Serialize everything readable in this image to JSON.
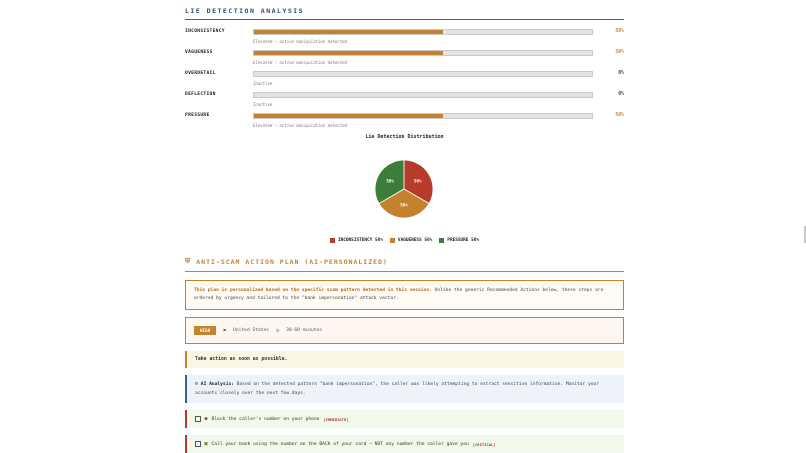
{
  "section_title": "LIE DETECTION ANALYSIS",
  "metrics": [
    {
      "label": "INCONSISTENCY",
      "value": 56,
      "pct": "56%",
      "note": "Elevated — active manipulation detected"
    },
    {
      "label": "VAGUENESS",
      "value": 56,
      "pct": "56%",
      "note": "Elevated — active manipulation detected"
    },
    {
      "label": "OVERDETAIL",
      "value": 0,
      "pct": "0%",
      "note": "Inactive"
    },
    {
      "label": "DEFLECTION",
      "value": 0,
      "pct": "0%",
      "note": "Inactive"
    },
    {
      "label": "PRESSURE",
      "value": 56,
      "pct": "56%",
      "note": "Elevated — active manipulation detected"
    }
  ],
  "chart_data": {
    "type": "pie",
    "title": "Lie Detection Distribution",
    "slices": [
      {
        "name": "INCONSISTENCY",
        "value": 56,
        "label": "56%",
        "color": "#b83a2b"
      },
      {
        "name": "VAGUENESS",
        "value": 56,
        "label": "56%",
        "color": "#c4822f"
      },
      {
        "name": "PRESSURE",
        "value": 56,
        "label": "56%",
        "color": "#3d7d3a"
      }
    ],
    "legend": [
      "INCONSISTENCY 56%",
      "VAGUENESS 56%",
      "PRESSURE 56%"
    ],
    "legend_position": "bottom"
  },
  "plan": {
    "icon": "shield-icon",
    "title": "ANTI-SCAM ACTION PLAN (AI-PERSONALIZED)",
    "intro_bold": "This plan is personalized based on the specific scam pattern detected in this session.",
    "intro_rest": " Unlike the generic Recommended Actions below, these steps are ordered by urgency and tailored to the \"bank impersonation\" attack vector.",
    "badge": "HIGH",
    "country": "United States",
    "duration": "30-60 minutes",
    "warning": "Take action as soon as possible.",
    "ai_label": "AI Analysis:",
    "ai_text": " Based on the detected pattern \"bank impersonation\", the caller was likely attempting to extract sensitive information. Monitor your accounts closely over the next few days.",
    "actions": [
      {
        "text": "Block the caller's number on your phone",
        "tag": "[IMMEDIATE]"
      },
      {
        "text": "Call your bank using the number on the BACK of your card — NOT any number the caller gave you",
        "tag": "[CRITICAL]"
      }
    ]
  },
  "colors": {
    "accent": "#c4822f",
    "navy": "#2b4a78",
    "red": "#b83a2b",
    "green": "#3d7d3a"
  }
}
